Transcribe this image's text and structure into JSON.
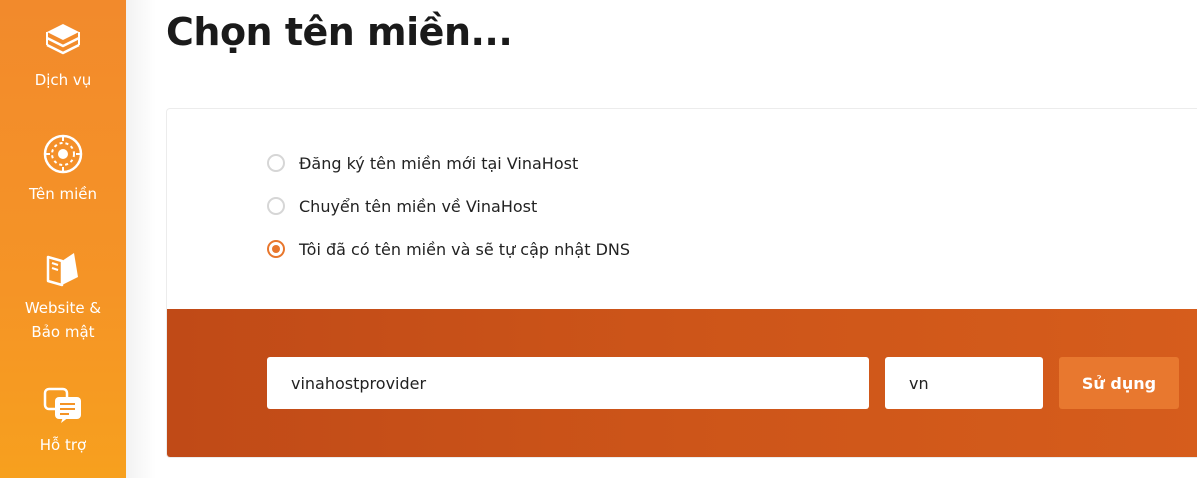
{
  "sidebar": {
    "items": [
      {
        "label_lines": [
          "Dịch vụ"
        ],
        "icon": "layers-icon"
      },
      {
        "label_lines": [
          "Tên miền"
        ],
        "icon": "globe-icon"
      },
      {
        "label_lines": [
          "Website &",
          "Bảo mật"
        ],
        "icon": "book-icon"
      },
      {
        "label_lines": [
          "Hỗ trợ"
        ],
        "icon": "chat-support-icon"
      }
    ]
  },
  "page": {
    "title": "Chọn tên miền..."
  },
  "options": [
    {
      "label": "Đăng ký tên miền mới tại VinaHost",
      "checked": false
    },
    {
      "label": "Chuyển tên miền về VinaHost",
      "checked": false
    },
    {
      "label": "Tôi đã có tên miền và sẽ tự cập nhật DNS",
      "checked": true
    }
  ],
  "domain_form": {
    "domain_value": "vinahostprovider",
    "tld_value": "vn",
    "submit_label": "Sử dụng"
  },
  "colors": {
    "sidebar_orange": "#f28a2c",
    "banner_orange": "#c04a17",
    "accent": "#e8762c"
  }
}
